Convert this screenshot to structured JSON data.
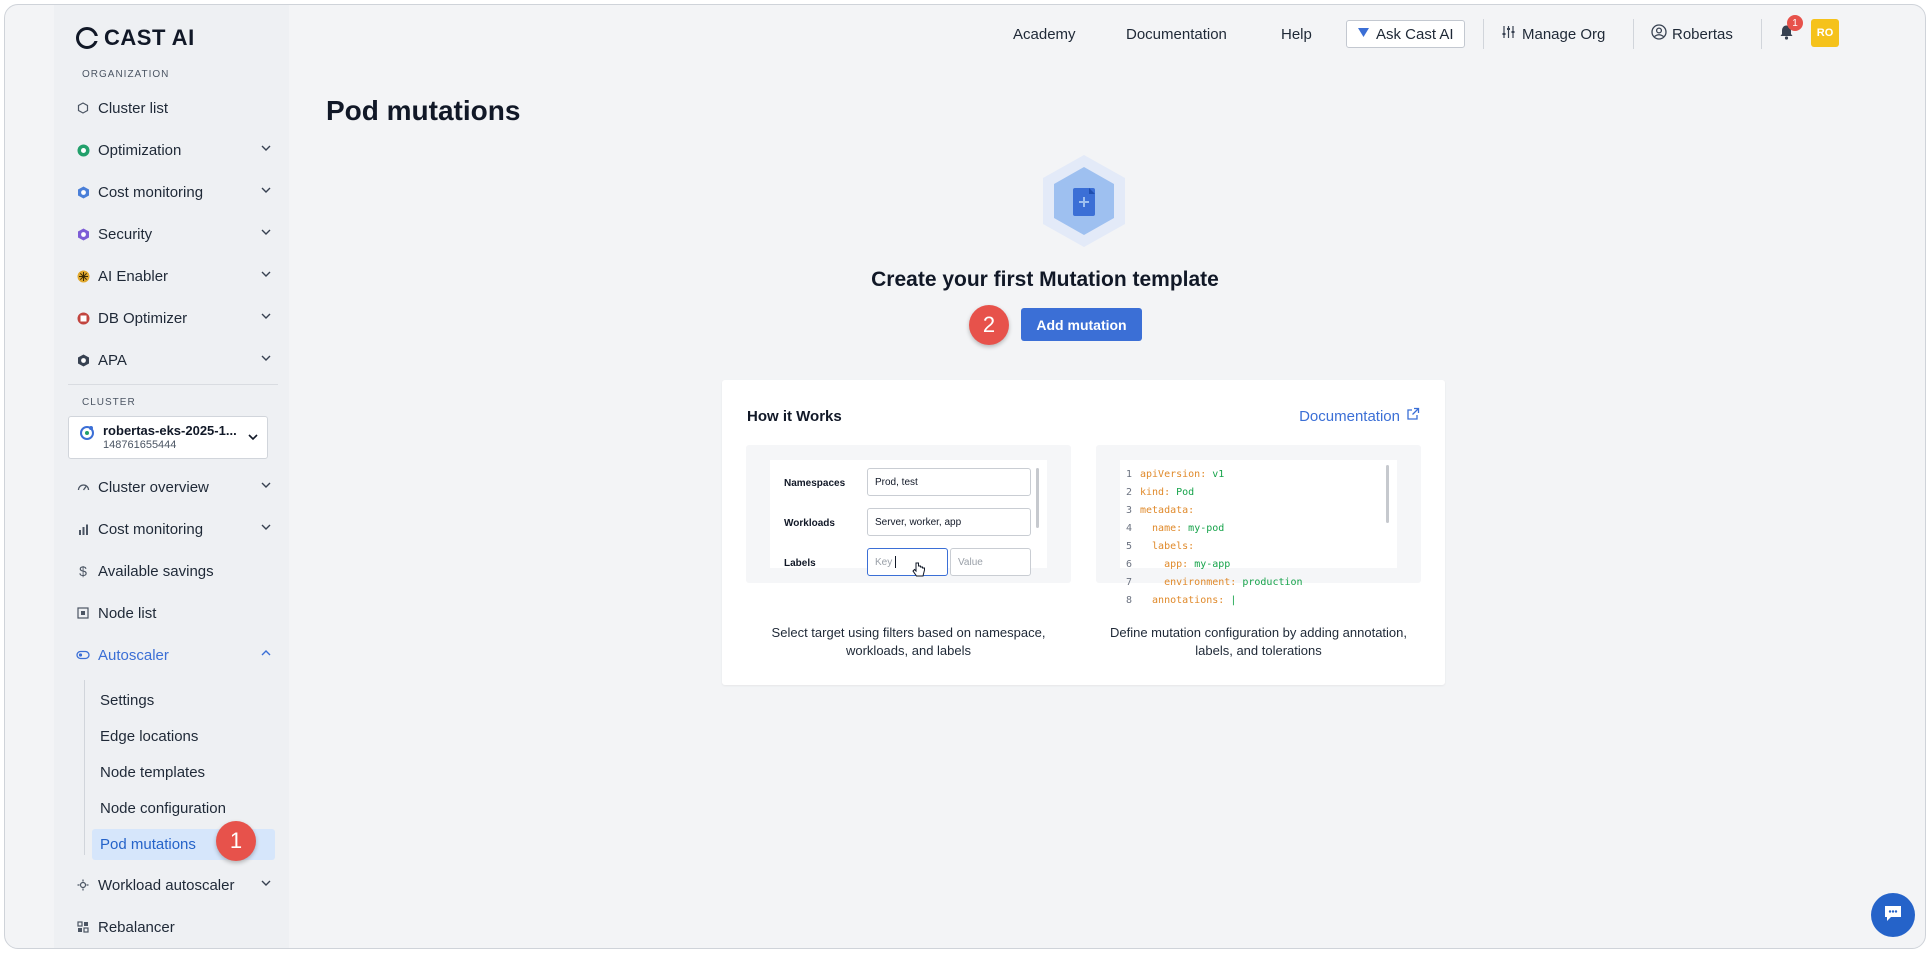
{
  "app": {
    "brand": "CAST AI",
    "accent": "#3b6fd6"
  },
  "sidebar": {
    "org_label": "ORGANIZATION",
    "org_items": [
      {
        "label": "Cluster list",
        "icon": "hexagon-icon"
      },
      {
        "label": "Optimization",
        "icon": "optimization-icon"
      },
      {
        "label": "Cost monitoring",
        "icon": "cost-monitoring-icon"
      },
      {
        "label": "Security",
        "icon": "security-icon"
      },
      {
        "label": "AI Enabler",
        "icon": "ai-enabler-icon"
      },
      {
        "label": "DB Optimizer",
        "icon": "db-optimizer-icon"
      },
      {
        "label": "APA",
        "icon": "apa-icon"
      }
    ],
    "cluster_label": "CLUSTER",
    "cluster": {
      "name": "robertas-eks-2025-1...",
      "id": "148761655444"
    },
    "cluster_items": [
      {
        "label": "Cluster overview"
      },
      {
        "label": "Cost monitoring"
      },
      {
        "label": "Available savings"
      },
      {
        "label": "Node list"
      },
      {
        "label": "Autoscaler"
      }
    ],
    "autoscaler_sub": [
      {
        "label": "Settings"
      },
      {
        "label": "Edge locations"
      },
      {
        "label": "Node templates"
      },
      {
        "label": "Node configuration"
      },
      {
        "label": "Pod mutations"
      }
    ],
    "bottom_items": [
      {
        "label": "Workload autoscaler"
      },
      {
        "label": "Rebalancer"
      }
    ],
    "step_badge": "1"
  },
  "topbar": {
    "links": [
      "Academy",
      "Documentation",
      "Help"
    ],
    "ask_label": "Ask Cast AI",
    "manage_org": "Manage Org",
    "user": "Robertas",
    "notifications": "1",
    "avatar_initials": "RO"
  },
  "main": {
    "title": "Pod mutations",
    "empty_title": "Create your first Mutation template",
    "add_button": "Add mutation",
    "step_badge": "2",
    "how": {
      "title": "How it Works",
      "doc_link": "Documentation",
      "form": {
        "namespaces_label": "Namespaces",
        "namespaces_value": "Prod, test",
        "workloads_label": "Workloads",
        "workloads_value": "Server, worker, app",
        "labels_label": "Labels",
        "key_placeholder": "Key",
        "value_placeholder": "Value"
      },
      "left_caption": "Select target using filters based on namespace, workloads, and labels",
      "right_caption": "Define mutation configuration by adding annotation, labels, and tolerations",
      "code": [
        {
          "n": "1",
          "k": "apiVersion:",
          "v": " v1"
        },
        {
          "n": "2",
          "k": "kind:",
          "v": " Pod"
        },
        {
          "n": "3",
          "k": "metadata:",
          "v": ""
        },
        {
          "n": "4",
          "k": "  name:",
          "v": " my-pod"
        },
        {
          "n": "5",
          "k": "  labels:",
          "v": ""
        },
        {
          "n": "6",
          "k": "    app:",
          "v": " my-app"
        },
        {
          "n": "7",
          "k": "    environment:",
          "v": " production"
        },
        {
          "n": "8",
          "k": "  annotations:",
          "v": " |"
        }
      ]
    }
  }
}
